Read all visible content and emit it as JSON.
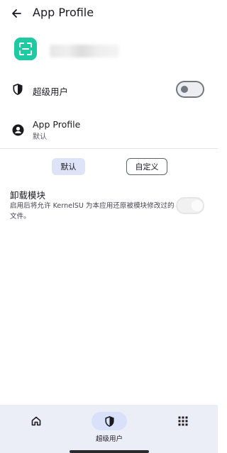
{
  "app_bar": {
    "back_icon": "arrow-back-icon",
    "title": "App Profile"
  },
  "app_header": {
    "icon": "scan-frame-icon",
    "icon_color": "#1fc9a2"
  },
  "superuser_row": {
    "icon": "shield-icon",
    "label": "超级用户",
    "toggle_on": false
  },
  "profile_row": {
    "icon": "account-circle-icon",
    "title": "App Profile",
    "subtitle": "默认"
  },
  "profile_mode": {
    "default_label": "默认",
    "custom_label": "自定义",
    "selected": "default"
  },
  "umount_modules": {
    "title": "卸载模块",
    "description": "启用后将允许 KernelSU 为本应用还原被模块修改过的文件。",
    "toggle_on": true,
    "toggle_enabled": false
  },
  "bottom_nav": {
    "items": [
      {
        "icon": "home-icon",
        "label": "",
        "active": false
      },
      {
        "icon": "shield-icon",
        "label": "超级用户",
        "active": true
      },
      {
        "icon": "apps-grid-icon",
        "label": "",
        "active": false
      }
    ]
  },
  "colors": {
    "accent_container": "#d8e1f9",
    "nav_background": "#eceef7",
    "app_icon": "#1fc9a2"
  }
}
